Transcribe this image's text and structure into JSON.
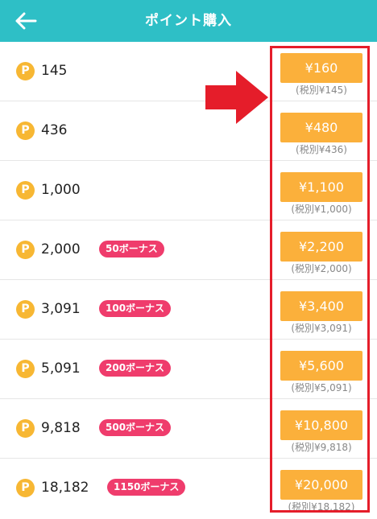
{
  "header": {
    "title": "ポイント購入",
    "background": "#2ebfc6"
  },
  "colors": {
    "coin": "#f7b733",
    "bonus_badge": "#ef3c6c",
    "price_button": "#fbb03b",
    "annotation": "#e51d2a"
  },
  "items": [
    {
      "points": "145",
      "bonus": "",
      "price": "¥160",
      "tax_note": "(税別¥145)"
    },
    {
      "points": "436",
      "bonus": "",
      "price": "¥480",
      "tax_note": "(税別¥436)"
    },
    {
      "points": "1,000",
      "bonus": "",
      "price": "¥1,100",
      "tax_note": "(税別¥1,000)"
    },
    {
      "points": "2,000",
      "bonus": "50ボーナス",
      "price": "¥2,200",
      "tax_note": "(税別¥2,000)"
    },
    {
      "points": "3,091",
      "bonus": "100ボーナス",
      "price": "¥3,400",
      "tax_note": "(税別¥3,091)"
    },
    {
      "points": "5,091",
      "bonus": "200ボーナス",
      "price": "¥5,600",
      "tax_note": "(税別¥5,091)"
    },
    {
      "points": "9,818",
      "bonus": "500ボーナス",
      "price": "¥10,800",
      "tax_note": "(税別¥9,818)"
    },
    {
      "points": "18,182",
      "bonus": "1150ボーナス",
      "price": "¥20,000",
      "tax_note": "(税別¥18,182)"
    }
  ],
  "coin_label": "P"
}
